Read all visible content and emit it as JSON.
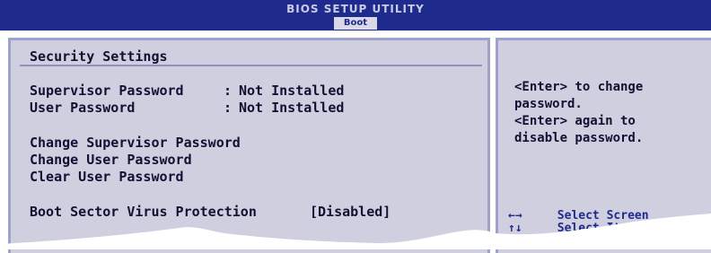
{
  "header": {
    "title": "BIOS SETUP UTILITY",
    "active_tab": "Boot"
  },
  "main": {
    "section_title": "Security Settings",
    "supervisor_password_label": "Supervisor Password",
    "supervisor_password_value": "Not Installed",
    "user_password_label": "User Password",
    "user_password_value": "Not Installed",
    "menu_items": [
      "Change Supervisor Password",
      "Change User Password",
      "Clear User Password"
    ],
    "boot_sector_label": "Boot Sector Virus Protection",
    "boot_sector_value": "[Disabled]"
  },
  "help": {
    "lines": [
      "<Enter> to change",
      "password.",
      "<Enter> again to",
      "disable password."
    ]
  },
  "keys": [
    {
      "key": "←→",
      "action": "Select Screen"
    },
    {
      "key": "↑↓",
      "action": "Select Item"
    }
  ],
  "colors": {
    "header_bg": "#1e2a8c",
    "panel_bg": "#cfcfe0",
    "panel_border": "#9ea2c9",
    "text": "#111133"
  }
}
